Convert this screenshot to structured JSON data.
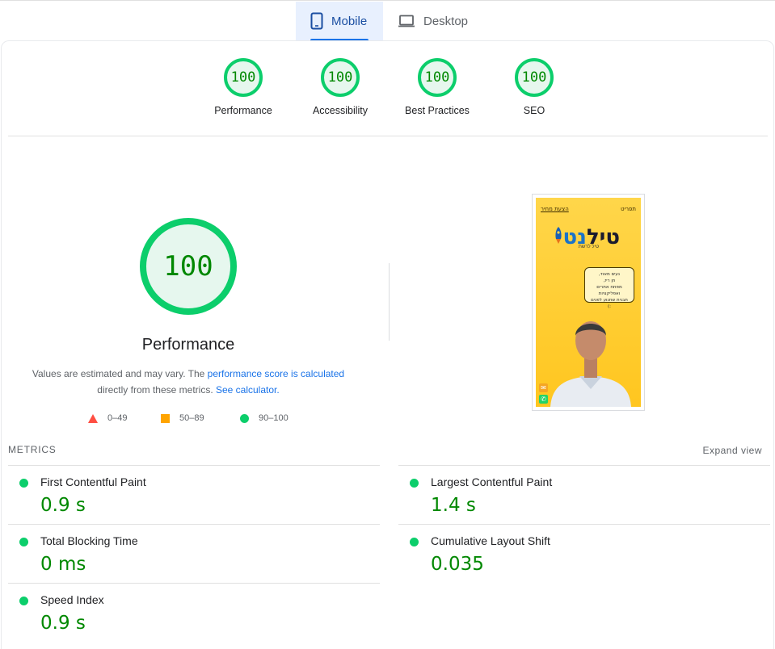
{
  "tabs": [
    {
      "label": "Mobile",
      "icon": "smartphone-icon",
      "active": true
    },
    {
      "label": "Desktop",
      "icon": "laptop-icon",
      "active": false
    }
  ],
  "categories": [
    {
      "score": "100",
      "label": "Performance"
    },
    {
      "score": "100",
      "label": "Accessibility"
    },
    {
      "score": "100",
      "label": "Best Practices"
    },
    {
      "score": "100",
      "label": "SEO"
    }
  ],
  "summary": {
    "score": "100",
    "title": "Performance",
    "desc_pre": "Values are estimated and may vary. The ",
    "desc_link1": "performance score is calculated",
    "desc_mid": " directly from these metrics. ",
    "desc_link2": "See calculator.",
    "legend": [
      {
        "range": "0–49",
        "shape": "triangle",
        "color": "#ff4e42"
      },
      {
        "range": "50–89",
        "shape": "square",
        "color": "#ffa400"
      },
      {
        "range": "90–100",
        "shape": "circle",
        "color": "#0cce6b"
      }
    ]
  },
  "screenshot": {
    "nav_brand": "תפריט",
    "nav_cta": "הצעת מחיר",
    "logo_main": "טיל",
    "logo_accent": "נט",
    "logo_sub": "טיל לרשת",
    "bubble_l1": "נעים מאוד,",
    "bubble_l2": "חן ריז,",
    "bubble_l3": "מפתח אתרים ואפליקציות",
    "bubble_l4": "תבנית שתנוע לפנים :)"
  },
  "metrics": {
    "heading": "METRICS",
    "expand_label": "Expand view",
    "items": [
      {
        "name": "First Contentful Paint",
        "value": "0.9 s"
      },
      {
        "name": "Largest Contentful Paint",
        "value": "1.4 s"
      },
      {
        "name": "Total Blocking Time",
        "value": "0 ms"
      },
      {
        "name": "Cumulative Layout Shift",
        "value": "0.035"
      },
      {
        "name": "Speed Index",
        "value": "0.9 s"
      }
    ]
  },
  "colors": {
    "pass": "#0cce6b",
    "pass_text": "#008800",
    "accent": "#1a73e8"
  }
}
